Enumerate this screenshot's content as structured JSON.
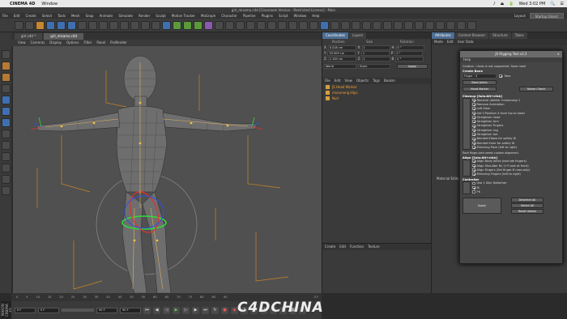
{
  "macbar": {
    "apple": "",
    "app": "CINEMA 4D",
    "window": "Window",
    "right": [
      "♪",
      "⏏",
      "🔋",
      "Wed 3:02 PM",
      "🔍",
      "☰"
    ]
  },
  "title": "girl_misamo.c4d [Classroom Version - Restricted License] - Main",
  "menu": [
    "File",
    "Edit",
    "Create",
    "Select",
    "Tools",
    "Mesh",
    "Snap",
    "Animate",
    "Simulate",
    "Render",
    "Sculpt",
    "Motion Tracker",
    "MoGraph",
    "Character",
    "Pipeline",
    "Plugins",
    "Script",
    "Window",
    "Help"
  ],
  "layout": {
    "label": "Layout:",
    "value": "Startup (User)"
  },
  "viewport": {
    "tabs": [
      "girl.c4d *",
      "girl_misamo.c4d"
    ],
    "menu": [
      "View",
      "Cameras",
      "Display",
      "Options",
      "Filter",
      "Panel",
      "ProRender"
    ]
  },
  "coordinates": {
    "tabs": [
      "Coordinates",
      "Layers"
    ],
    "headers": [
      "Position",
      "Size",
      "Rotation"
    ],
    "rows": [
      {
        "axis": "X",
        "pos": "0.028 cm",
        "size": "1",
        "rot": "H",
        "rval": "0 °"
      },
      {
        "axis": "Y",
        "pos": "93.909 cm",
        "size": "1",
        "rot": "P",
        "rval": "0 °"
      },
      {
        "axis": "Z",
        "pos": "1.163 cm",
        "size": "1",
        "rot": "B",
        "rval": "0 °"
      }
    ],
    "mode1": "World",
    "mode2": "Scale",
    "apply": "Apply"
  },
  "objects": {
    "menu": [
      "File",
      "Edit",
      "View",
      "Objects",
      "Tags",
      "Bookm"
    ],
    "items": [
      {
        "name": "JS Head Marker",
        "orange": false
      },
      {
        "name": "mixamorig:Hips",
        "orange": true
      },
      {
        "name": "Null",
        "orange": true
      }
    ]
  },
  "materials": {
    "menu": [
      "Create",
      "Edit",
      "Function",
      "Texture"
    ]
  },
  "attributes": {
    "tabs": [
      "Attributes",
      "Content Browser",
      "Structure",
      "Takes"
    ],
    "menu": [
      "Mode",
      "Edit",
      "User Data"
    ],
    "side_label": "Material Editor"
  },
  "dialog": {
    "title": "JS Rigging Tool v2.2",
    "close": "×",
    "menu": "Help",
    "caution": "Caution : Undo is not supported. Save now!",
    "create_bone": "Create Bone",
    "finger_select": "Finger : 5",
    "toes_label": "Toes",
    "base_joints": "Base Joints",
    "head_marker": "Head Marker",
    "name_check": "Name Check",
    "cleanup": "Cleanup [Solo:Alt+click]",
    "cleanup_items": [
      "Rename (delete 'mixamorig:')",
      "Remove Animation",
      "Left Xlow",
      "Set 0 Position X from hip to head",
      "Straighten head",
      "Straighten Arm",
      "Straighten Fingers",
      "Straighten Leg",
      "Straighten toe",
      "Bended Elbow for safety IK",
      "Bended Knee for safety IK",
      "Mirroring Pose (left to right)"
    ],
    "finger_note": "Each finger-joint needs custom alignment.",
    "align": "Align [Solo:Alt+click]",
    "align_items": [
      "Align Body joints (exclude fingers)",
      "Align Shoulder Rx (+Y look at front)",
      "Align Fingers (Set finger-R manually)",
      "Mirroring Fingers (left to right)"
    ],
    "controller": "Controller",
    "controller_items": [
      "Use 1 Skin Deformer",
      "IK",
      "FK"
    ],
    "apply": "Apply",
    "deselect_all": "Deselect All",
    "select_all": "Select All",
    "reset_values": "Reset Values"
  },
  "timeline": {
    "ticks": [
      "0",
      "5",
      "10",
      "15",
      "20",
      "25",
      "30",
      "35",
      "40",
      "45",
      "50",
      "55",
      "60",
      "65",
      "70",
      "75",
      "80",
      "85",
      "90"
    ],
    "frame": "0 F"
  },
  "transport": {
    "start": "0 F",
    "cur": "0 F",
    "end": "90 F",
    "end2": "90 F"
  },
  "maxon": "MAXON CINEMA 4D",
  "watermark": "C4DCHINA"
}
